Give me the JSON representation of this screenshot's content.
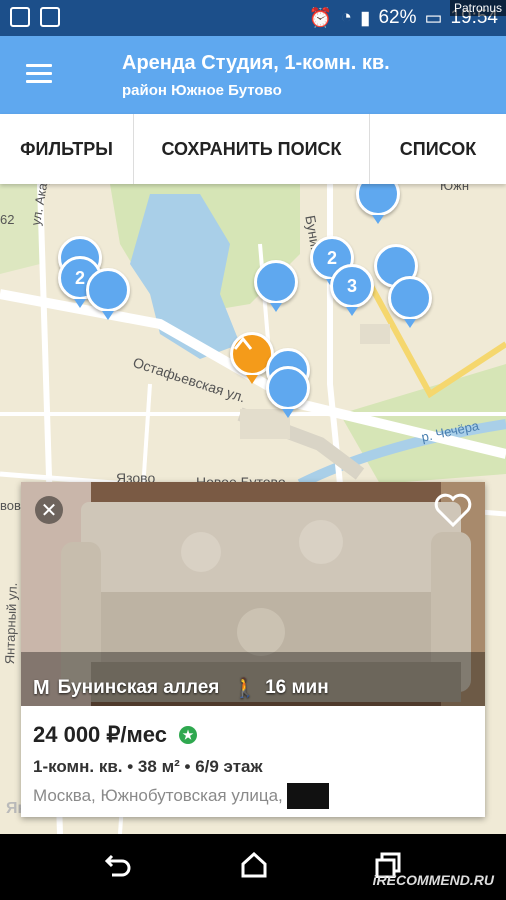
{
  "status_bar": {
    "battery": "62%",
    "time": "19:54",
    "watermark": "Patronus"
  },
  "app_bar": {
    "title": "Аренда Студия, 1-комн. кв.",
    "subtitle": "район Южное Бутово"
  },
  "tabs": [
    {
      "label": "ФИЛЬТРЫ"
    },
    {
      "label": "СОХРАНИТЬ ПОИСК"
    },
    {
      "label": "СПИСОК"
    }
  ],
  "map": {
    "streets": [
      "ул. Академ",
      "Бунин",
      "Остафьевская ул.",
      "р. Чечёра",
      "Язово",
      "Новое Бутово",
      "Янтарный ул.",
      "Южн",
      "62",
      "вов"
    ],
    "pin_counts": [
      "2",
      "2",
      "3"
    ],
    "logo": "Яндекс"
  },
  "card": {
    "metro_station": "Бунинская аллея",
    "walk_time": "16 мин",
    "price": "24 000 ₽/мес",
    "details": "1-комн. кв. • 38 м² • 6/9 этаж",
    "address": "Москва, Южнобутовская улица,"
  },
  "bottom_watermark": "iRECOMMEND.RU",
  "colors": {
    "accent": "#5fa8ef",
    "status_bar": "#1c4f8a",
    "orange_pin": "#f49b1a",
    "verified_badge": "#2fa84f"
  }
}
